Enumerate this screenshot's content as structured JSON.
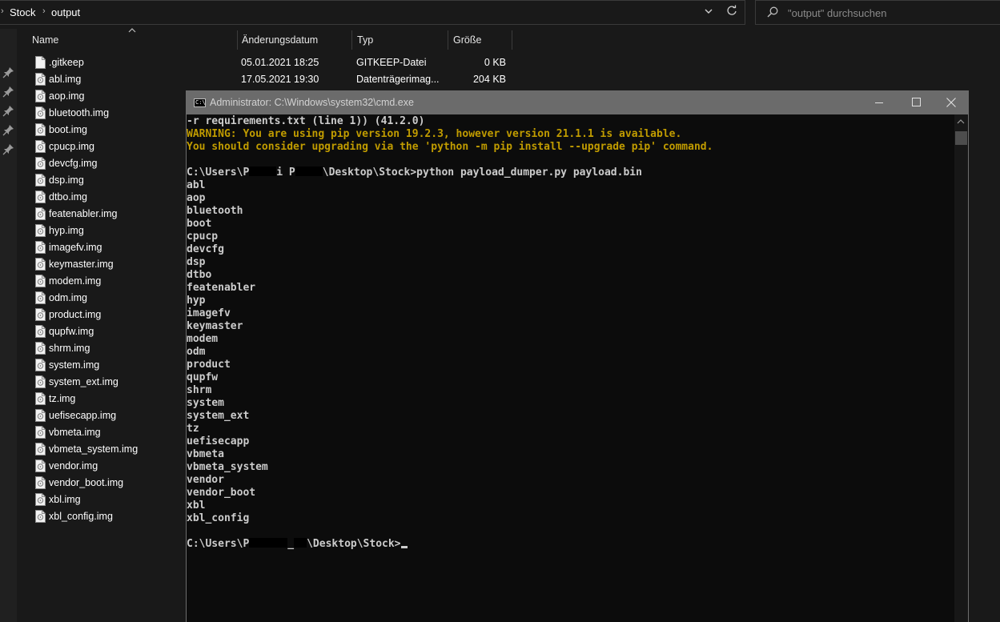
{
  "explorer": {
    "breadcrumb": [
      "Stock",
      "output"
    ],
    "search_placeholder": "\"output\" durchsuchen",
    "columns": {
      "name": "Name",
      "date": "Änderungsdatum",
      "type": "Typ",
      "size": "Größe"
    },
    "files": [
      {
        "name": ".gitkeep",
        "date": "05.01.2021 18:25",
        "type": "GITKEEP-Datei",
        "size": "0 KB"
      },
      {
        "name": "abl.img",
        "date": "17.05.2021 19:30",
        "type": "Datenträgerimag...",
        "size": "204 KB"
      },
      {
        "name": "aop.img"
      },
      {
        "name": "bluetooth.img"
      },
      {
        "name": "boot.img"
      },
      {
        "name": "cpucp.img"
      },
      {
        "name": "devcfg.img"
      },
      {
        "name": "dsp.img"
      },
      {
        "name": "dtbo.img"
      },
      {
        "name": "featenabler.img"
      },
      {
        "name": "hyp.img"
      },
      {
        "name": "imagefv.img"
      },
      {
        "name": "keymaster.img"
      },
      {
        "name": "modem.img"
      },
      {
        "name": "odm.img"
      },
      {
        "name": "product.img"
      },
      {
        "name": "qupfw.img"
      },
      {
        "name": "shrm.img"
      },
      {
        "name": "system.img"
      },
      {
        "name": "system_ext.img"
      },
      {
        "name": "tz.img"
      },
      {
        "name": "uefisecapp.img"
      },
      {
        "name": "vbmeta.img"
      },
      {
        "name": "vbmeta_system.img"
      },
      {
        "name": "vendor.img"
      },
      {
        "name": "vendor_boot.img"
      },
      {
        "name": "xbl.img"
      },
      {
        "name": "xbl_config.img"
      }
    ]
  },
  "console": {
    "title": "Administrator: C:\\Windows\\system32\\cmd.exe",
    "icon_label": "C:\\",
    "colors": {
      "warning": "#c19c00",
      "text": "#cccccc",
      "background": "#0c0c0c"
    },
    "line_requirements": "-r requirements.txt (line 1)) (41.2.0)",
    "warning_1": "WARNING: You are using pip version 19.2.3, however version 21.1.1 is available.",
    "warning_2": "You should consider upgrading via the 'python -m pip install --upgrade pip' command.",
    "prompt_1_start": "C:\\Users\\P",
    "prompt_1_mid": "i P",
    "prompt_1_end": "\\Desktop\\Stock>python payload_dumper.py payload.bin",
    "partitions": [
      "abl",
      "aop",
      "bluetooth",
      "boot",
      "cpucp",
      "devcfg",
      "dsp",
      "dtbo",
      "featenabler",
      "hyp",
      "imagefv",
      "keymaster",
      "modem",
      "odm",
      "product",
      "qupfw",
      "shrm",
      "system",
      "system_ext",
      "tz",
      "uefisecapp",
      "vbmeta",
      "vbmeta_system",
      "vendor",
      "vendor_boot",
      "xbl",
      "xbl_config"
    ],
    "prompt_2_start": "C:\\Users\\P",
    "prompt_2_mid": "_",
    "prompt_2_end": "\\Desktop\\Stock>"
  }
}
